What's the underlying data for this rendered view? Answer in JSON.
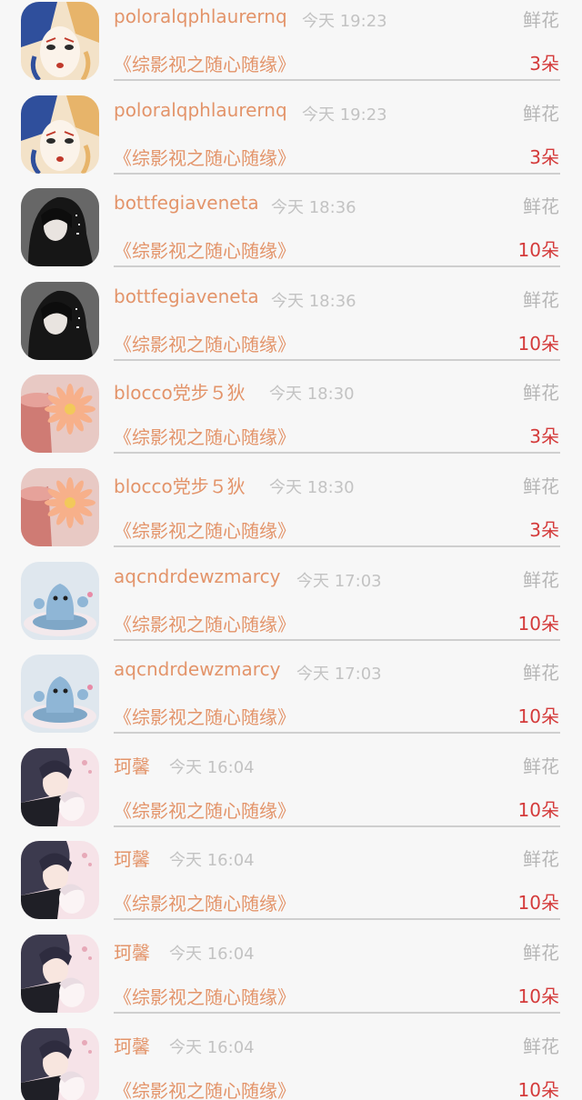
{
  "gift_rows": [
    {
      "avatar": "avatar-opera-mask",
      "username": "poloralqphlaurernq",
      "time": "今天 19:23",
      "gift_type": "鲜花",
      "book_title": "《综影视之随心随缘》",
      "count": "3朵"
    },
    {
      "avatar": "avatar-opera-mask",
      "username": "poloralqphlaurernq",
      "time": "今天 19:23",
      "gift_type": "鲜花",
      "book_title": "《综影视之随心随缘》",
      "count": "3朵"
    },
    {
      "avatar": "avatar-hooded-girl",
      "username": "bottfegiaveneta",
      "time": "今天 18:36",
      "gift_type": "鲜花",
      "book_title": "《综影视之随心随缘》",
      "count": "10朵"
    },
    {
      "avatar": "avatar-hooded-girl",
      "username": "bottfegiaveneta",
      "time": "今天 18:36",
      "gift_type": "鲜花",
      "book_title": "《综影视之随心随缘》",
      "count": "10朵"
    },
    {
      "avatar": "avatar-pink-daisy",
      "username": "blocco党步５狄",
      "time": "今天 18:30",
      "gift_type": "鲜花",
      "book_title": "《综影视之随心随缘》",
      "count": "3朵"
    },
    {
      "avatar": "avatar-pink-daisy",
      "username": "blocco党步５狄",
      "time": "今天 18:30",
      "gift_type": "鲜花",
      "book_title": "《综影视之随心随缘》",
      "count": "3朵"
    },
    {
      "avatar": "avatar-blue-toy",
      "username": "aqcndrdewzmarcy",
      "time": "今天 17:03",
      "gift_type": "鲜花",
      "book_title": "《综影视之随心随缘》",
      "count": "10朵"
    },
    {
      "avatar": "avatar-blue-toy",
      "username": "aqcndrdewzmarcy",
      "time": "今天 17:03",
      "gift_type": "鲜花",
      "book_title": "《综影视之随心随缘》",
      "count": "10朵"
    },
    {
      "avatar": "avatar-anime-couple",
      "username": "珂馨",
      "time": "今天 16:04",
      "gift_type": "鲜花",
      "book_title": "《综影视之随心随缘》",
      "count": "10朵"
    },
    {
      "avatar": "avatar-anime-couple",
      "username": "珂馨",
      "time": "今天 16:04",
      "gift_type": "鲜花",
      "book_title": "《综影视之随心随缘》",
      "count": "10朵"
    },
    {
      "avatar": "avatar-anime-couple",
      "username": "珂馨",
      "time": "今天 16:04",
      "gift_type": "鲜花",
      "book_title": "《综影视之随心随缘》",
      "count": "10朵"
    },
    {
      "avatar": "avatar-anime-couple",
      "username": "珂馨",
      "time": "今天 16:04",
      "gift_type": "鲜花",
      "book_title": "《综影视之随心随缘》",
      "count": "10朵"
    }
  ],
  "colors": {
    "username": "#e3946a",
    "book_title": "#e3946a",
    "count": "#d43a3a",
    "time": "#c3c3c3",
    "gift_type": "#b6b6b6",
    "background": "#f7f7f7"
  }
}
